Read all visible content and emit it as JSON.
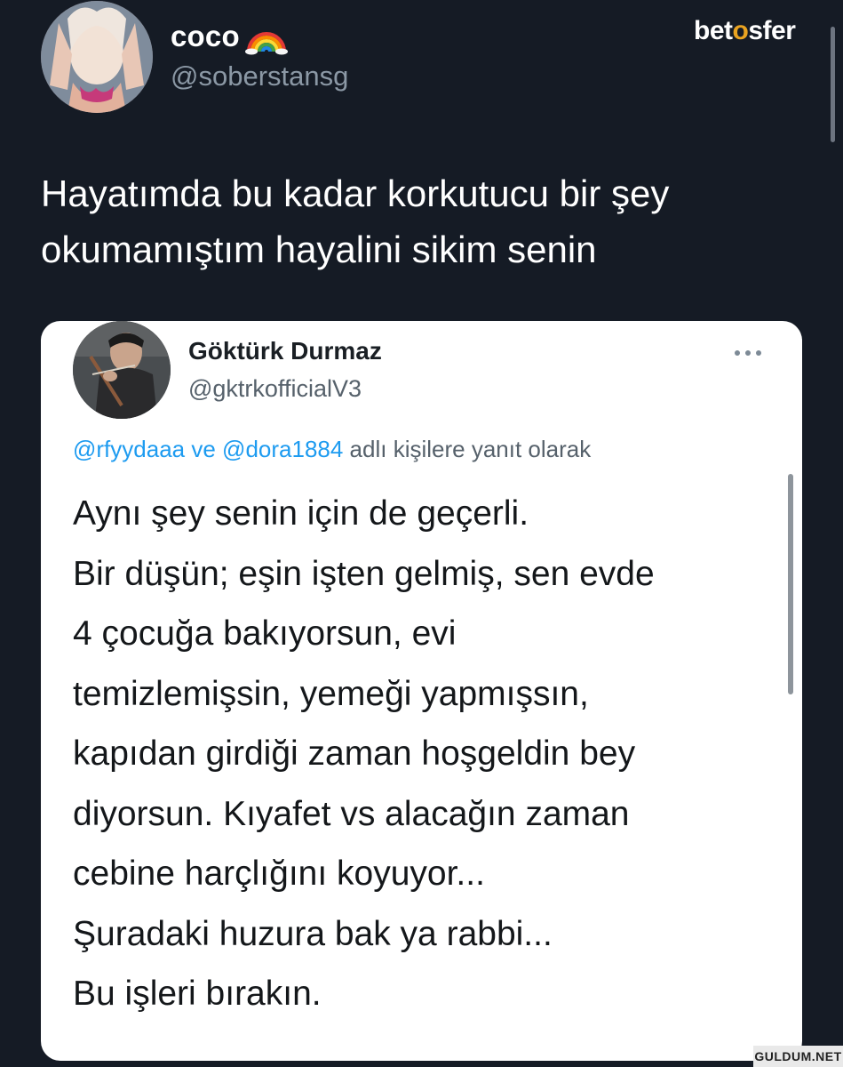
{
  "outer_tweet": {
    "author_name": "coco",
    "author_badge_icon": "rainbow-icon",
    "author_handle": "@soberstansg",
    "text": "Hayatımda bu kadar korkutucu bir şey\nokumamıştım hayalini sikim senin"
  },
  "brand": {
    "logo_text_pre": "bet",
    "logo_text_star": "o",
    "logo_text_post": "sfer",
    "accent_color": "#e9a321"
  },
  "quoted_tweet": {
    "author_name": "Göktürk Durmaz",
    "author_handle": "@gktrkofficialV3",
    "more_icon": "more-horizontal-icon",
    "reply_mention_1": "@rfyydaaa",
    "reply_joiner": " ve ",
    "reply_mention_2": "@dora1884",
    "reply_suffix": " adlı kişilere yanıt olarak",
    "text": "Aynı şey senin için de geçerli.\nBir düşün; eşin işten gelmiş, sen evde\n4 çocuğa bakıyorsun, evi\ntemizlemişsin, yemeği yapmışsın,\nkapıdan girdiği zaman hoşgeldin bey\ndiyorsun. Kıyafet vs alacağın zaman\ncebine harçlığını koyuyor...\nŞuradaki huzura bak ya rabbi...\nBu işleri bırakın."
  },
  "watermark": {
    "text": "GULDUM.NET"
  },
  "colors": {
    "background": "#151b25",
    "card_background": "#ffffff",
    "mention_blue": "#1d9bf0",
    "secondary_text": "#8b98a5"
  }
}
